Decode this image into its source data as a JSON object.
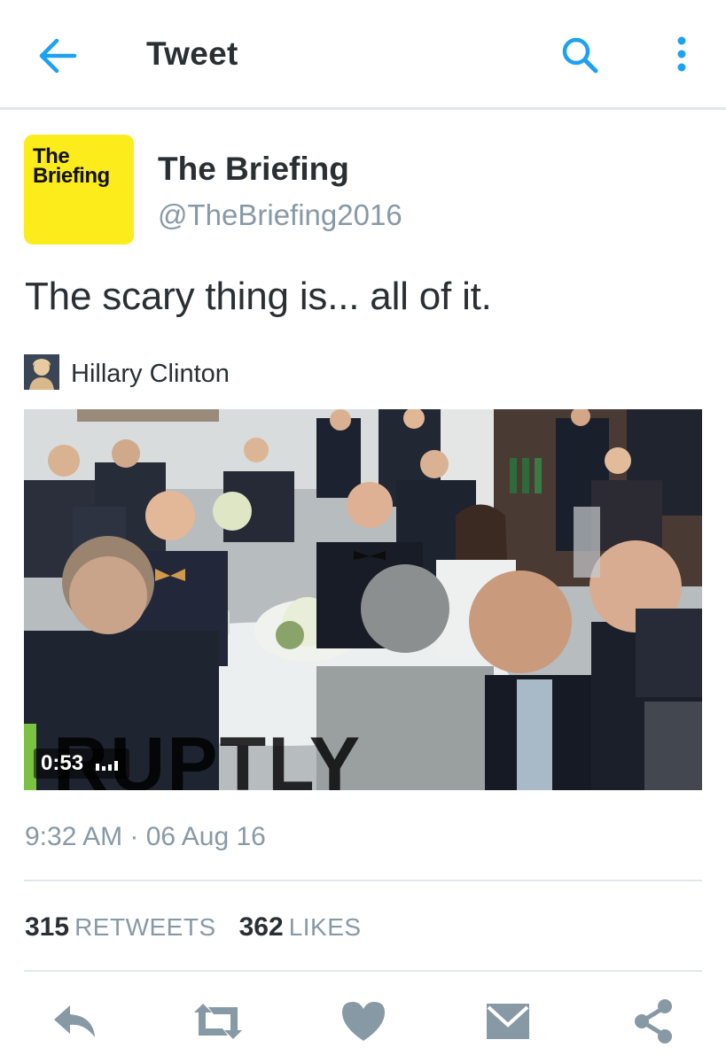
{
  "header": {
    "title": "Tweet"
  },
  "tweet": {
    "avatar_text": "The Briefing",
    "author_name": "The Briefing",
    "author_handle": "@TheBriefing2016",
    "text": "The scary thing is... all of it.",
    "timestamp": "9:32 AM · 06 Aug 16"
  },
  "card": {
    "source_name": "Hillary Clinton",
    "video_duration": "0:53",
    "watermark": "RUPTLY"
  },
  "stats": {
    "retweets_count": "315",
    "retweets_label": "RETWEETS",
    "likes_count": "362",
    "likes_label": "LIKES"
  },
  "colors": {
    "accent": "#1da1f2",
    "icon_gray": "#8899a6",
    "avatar_yellow": "#fdec1b"
  },
  "icons": {
    "back": "arrow-left-icon",
    "search": "search-icon",
    "more": "more-vertical-icon",
    "reply": "reply-icon",
    "retweet": "retweet-icon",
    "like": "heart-icon",
    "message": "envelope-icon",
    "share": "share-icon"
  }
}
